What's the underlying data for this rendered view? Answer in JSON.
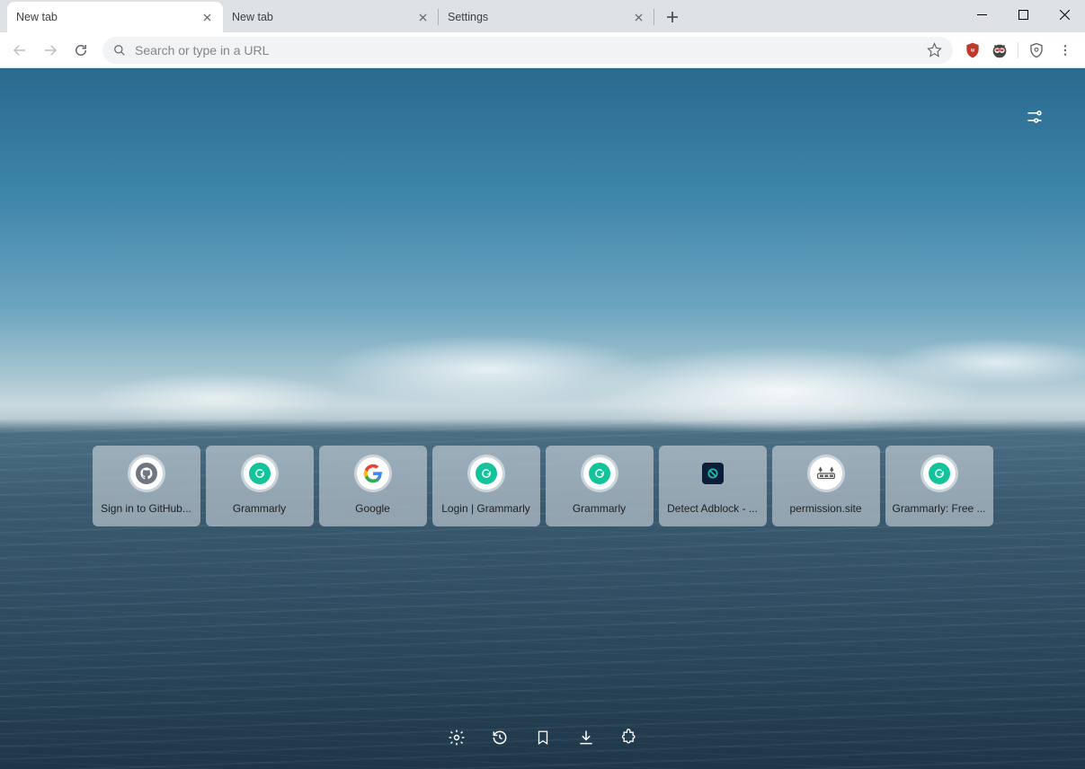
{
  "tabs": [
    {
      "title": "New tab",
      "active": true
    },
    {
      "title": "New tab",
      "active": false
    },
    {
      "title": "Settings",
      "active": false
    }
  ],
  "omnibox": {
    "placeholder": "Search or type in a URL",
    "value": ""
  },
  "extensions": [
    {
      "name": "ublock",
      "color": "#c0392b"
    },
    {
      "name": "privacy-badger",
      "color": "#f06030"
    },
    {
      "name": "shield",
      "color": "#5f6368"
    }
  ],
  "tiles": [
    {
      "label": "Sign in to GitHub...",
      "icon": "github"
    },
    {
      "label": "Grammarly",
      "icon": "grammarly"
    },
    {
      "label": "Google",
      "icon": "google"
    },
    {
      "label": "Login | Grammarly",
      "icon": "grammarly"
    },
    {
      "label": "Grammarly",
      "icon": "grammarly"
    },
    {
      "label": "Detect Adblock - ...",
      "icon": "adblock"
    },
    {
      "label": "permission.site",
      "icon": "permission"
    },
    {
      "label": "Grammarly: Free ...",
      "icon": "grammarly"
    }
  ],
  "bottom_buttons": [
    "settings",
    "history",
    "bookmarks",
    "downloads",
    "extensions"
  ]
}
